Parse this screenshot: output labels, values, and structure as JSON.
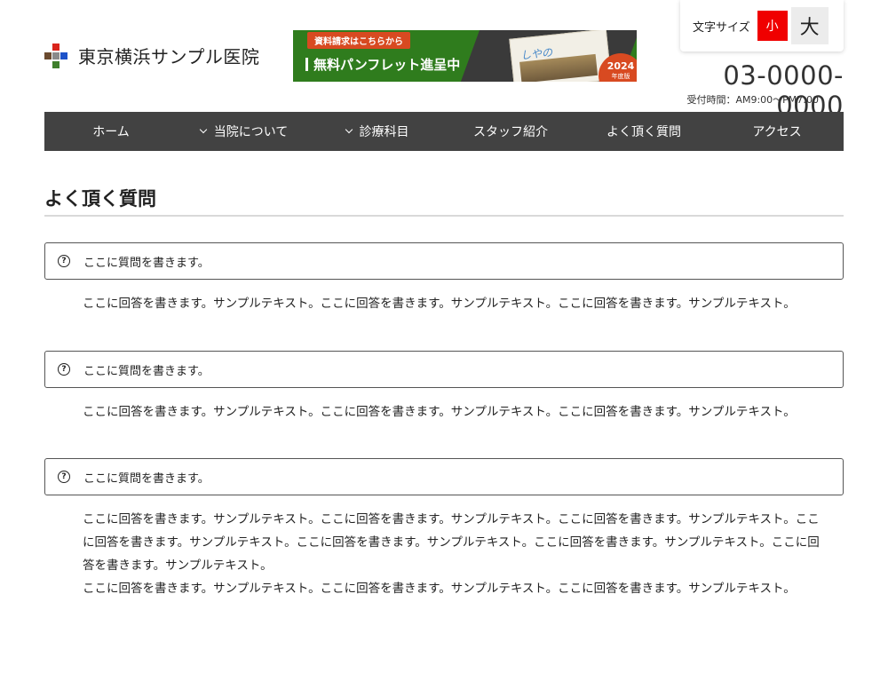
{
  "site": {
    "name": "東京横浜サンプル医院",
    "colors": {
      "nav_bg": "#424242",
      "accent_red": "#f00000",
      "banner_green": "#2f7c1d",
      "banner_orange": "#d84a21"
    }
  },
  "banner": {
    "tag": "資料請求はこちらから",
    "title": "無料パンフレット進呈中",
    "pamphlet_title": "しやの",
    "year": "2024",
    "year_suffix": "年度版"
  },
  "fontsize": {
    "label": "文字サイズ",
    "small": "小",
    "large": "大"
  },
  "contact": {
    "phone": "03-0000-0000",
    "hours": "受付時間：AM9:00〜PM7:00"
  },
  "nav": {
    "items": [
      {
        "label": "ホーム",
        "has_dropdown": false
      },
      {
        "label": "当院について",
        "has_dropdown": true
      },
      {
        "label": "診療科目",
        "has_dropdown": true
      },
      {
        "label": "スタッフ紹介",
        "has_dropdown": false
      },
      {
        "label": "よく頂く質問",
        "has_dropdown": false
      },
      {
        "label": "アクセス",
        "has_dropdown": false
      }
    ]
  },
  "main": {
    "title": "よく頂く質問",
    "faqs": [
      {
        "icon": "question-circle-icon",
        "question": "ここに質問を書きます。",
        "answers": [
          "ここに回答を書きます。サンプルテキスト。ここに回答を書きます。サンプルテキスト。ここに回答を書きます。サンプルテキスト。"
        ]
      },
      {
        "icon": "question-circle-icon",
        "question": "ここに質問を書きます。",
        "answers": [
          "ここに回答を書きます。サンプルテキスト。ここに回答を書きます。サンプルテキスト。ここに回答を書きます。サンプルテキスト。"
        ]
      },
      {
        "icon": "question-circle-icon",
        "question": "ここに質問を書きます。",
        "answers": [
          "ここに回答を書きます。サンプルテキスト。ここに回答を書きます。サンプルテキスト。ここに回答を書きます。サンプルテキスト。ここに回答を書きます。サンプルテキスト。ここに回答を書きます。サンプルテキスト。ここに回答を書きます。サンプルテキスト。ここに回答を書きます。サンプルテキスト。",
          "ここに回答を書きます。サンプルテキスト。ここに回答を書きます。サンプルテキスト。ここに回答を書きます。サンプルテキスト。"
        ]
      }
    ]
  }
}
